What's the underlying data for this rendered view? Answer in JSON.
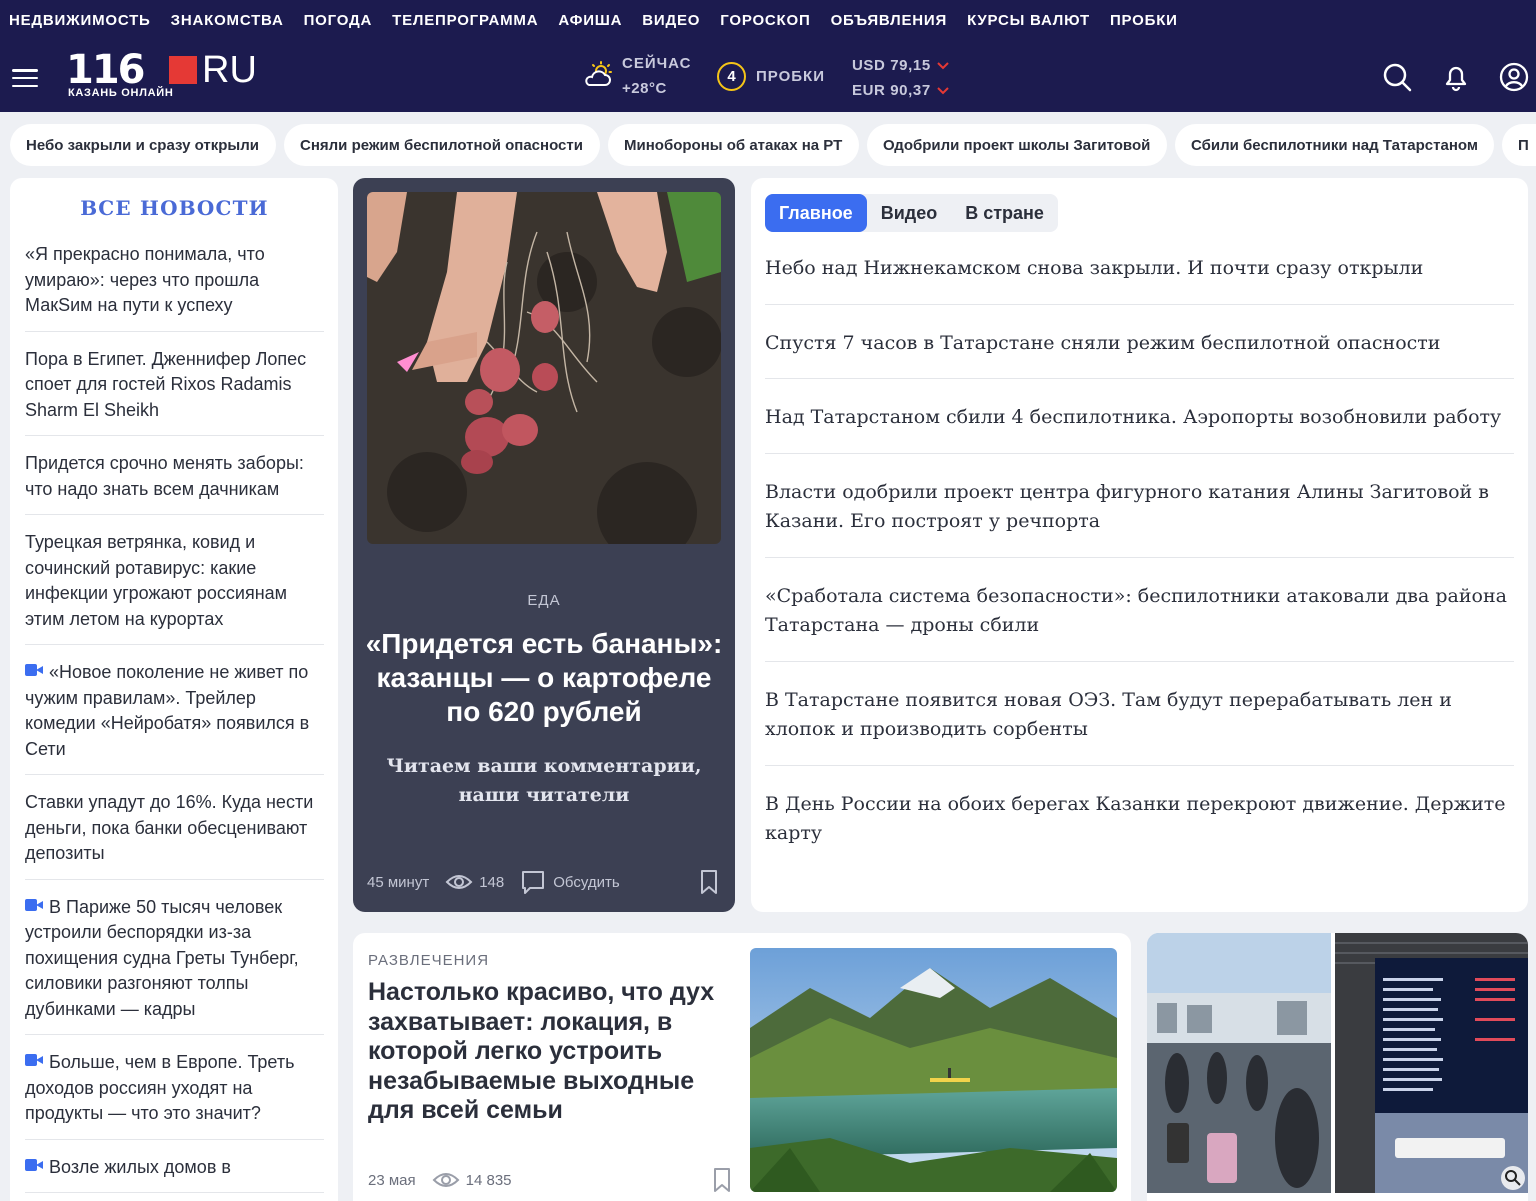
{
  "topnav": [
    "НЕДВИЖИМОСТЬ",
    "ЗНАКОМСТВА",
    "ПОГОДА",
    "ТЕЛЕПРОГРАММА",
    "АФИША",
    "ВИДЕО",
    "ГОРОСКОП",
    "ОБЪЯВЛЕНИЯ",
    "КУРСЫ ВАЛЮТ",
    "ПРОБКИ"
  ],
  "header": {
    "logo_number": "116",
    "logo_ru": "RU",
    "logo_sub": "КАЗАНЬ ОНЛАЙН",
    "weather_label": "СЕЙЧАС",
    "weather_temp": "+28°C",
    "traffic_level": "4",
    "traffic_label": "ПРОБКИ",
    "usd": "USD 79,15",
    "eur": "EUR 90,37",
    "icons": [
      "search-icon",
      "bell-icon",
      "user-icon"
    ]
  },
  "chips": [
    "Небо закрыли и сразу открыли",
    "Сняли режим беспилотной опасности",
    "Минобороны об атаках на РТ",
    "Одобрили проект школы Загитовой",
    "Сбили беспилотники над Татарстаном",
    "П"
  ],
  "all_news": {
    "title": "ВСЕ НОВОСТИ",
    "items": [
      {
        "text": "«Я прекрасно понимала, что умираю»: через что прошла МакSим на пути к успеху",
        "video": false
      },
      {
        "text": "Пора в Египет. Дженнифер Лопес споет для гостей Rixos Radamis Sharm El Sheikh",
        "video": false
      },
      {
        "text": "Придется срочно менять заборы: что надо знать всем дачникам",
        "video": false
      },
      {
        "text": "Турецкая ветрянка, ковид и сочинский ротавирус: какие инфекции угрожают россиянам этим летом на курортах",
        "video": false
      },
      {
        "text": "«Новое поколение не живет по чужим правилам». Трейлер комедии «Нейробатя» появился в Сети",
        "video": true
      },
      {
        "text": "Ставки упадут до 16%. Куда нести деньги, пока банки обесценивают депозиты",
        "video": false
      },
      {
        "text": "В Париже 50 тысяч человек устроили беспорядки из-за похищения судна Греты Тунберг, силовики разгоняют толпы дубинками — кадры",
        "video": true
      },
      {
        "text": "Больше, чем в Европе. Треть доходов россиян уходят на продукты — что это значит?",
        "video": true
      },
      {
        "text": "Возле жилых домов в",
        "video": true
      }
    ]
  },
  "featured": {
    "category": "ЕДА",
    "title": "«Придется есть бананы»: казанцы — о картофеле по 620 рублей",
    "subtitle": "Читаем ваши комментарии, наши читатели",
    "time": "45 минут",
    "views": "148",
    "discuss": "Обсудить"
  },
  "main": {
    "tabs": [
      "Главное",
      "Видео",
      "В стране"
    ],
    "items": [
      "Небо над Нижнекамском снова закрыли. И почти сразу открыли",
      "Спустя 7 часов в Татарстане сняли режим беспилотной опасности",
      "Над Татарстаном сбили 4 беспилотника. Аэропорты возобновили работу",
      "Власти одобрили проект центра фигурного катания Алины Загитовой в Казани. Его построят у речпорта",
      "«Сработала система безопасности»: беспилотники атаковали два района Татарстана — дроны сбили",
      "В Татарстане появится новая ОЭЗ. Там будут перерабатывать лен и хлопок и производить сорбенты",
      "В День России на обоих берегах Казанки перекроют движение. Держите карту"
    ]
  },
  "story": {
    "category": "РАЗВЛЕЧЕНИЯ",
    "title": "Настолько красиво, что дух захватывает: локация, в которой легко устроить незабываемые выходные для всей семьи",
    "date": "23 мая",
    "views": "14 835"
  },
  "colors": {
    "nav_bg": "#1c1b4f",
    "accent": "#3b6df0",
    "logo_red": "#e53935",
    "traffic_ring": "#f5c518",
    "card_dark": "#3c4053"
  }
}
